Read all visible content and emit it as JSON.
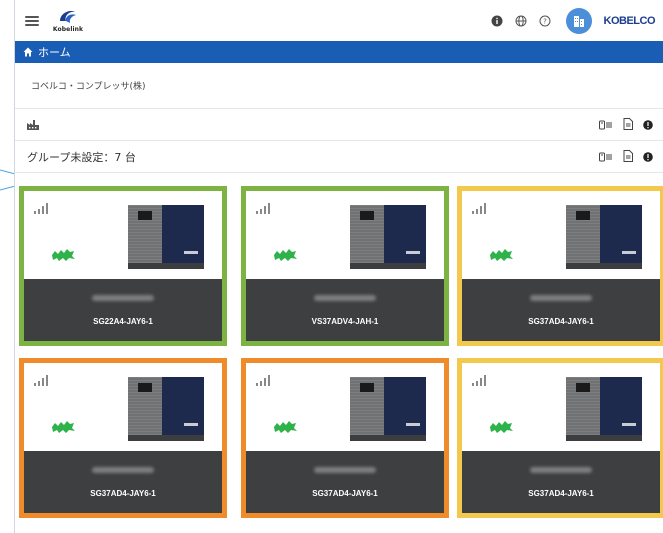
{
  "header": {
    "app_name": "Kobelink",
    "brand": "KOBELCO",
    "icons": [
      "info-icon",
      "globe-icon",
      "help-icon",
      "avatar"
    ]
  },
  "nav": {
    "home_label": "ホーム"
  },
  "company": {
    "name": "コベルコ・コンプレッサ(株)"
  },
  "group": {
    "label": "グループ未設定：7 台"
  },
  "cards": [
    {
      "model": "SG22A4-JAY6-1",
      "status_color": "#7cb342"
    },
    {
      "model": "VS37ADV4-JAH-1",
      "status_color": "#7cb342"
    },
    {
      "model": "SG37AD4-JAY6-1",
      "status_color": "#f2c94c"
    },
    {
      "model": "SG37AD4-JAY6-1",
      "status_color": "#f08b2c"
    },
    {
      "model": "SG37AD4-JAY6-1",
      "status_color": "#f08b2c"
    },
    {
      "model": "SG37AD4-JAY6-1",
      "status_color": "#f2c94c"
    }
  ],
  "colors": {
    "nav_bg": "#1a5db5",
    "card_bottom": "#3d3f40",
    "green": "#7cb342",
    "orange": "#f08b2c",
    "yellow": "#f2c94c"
  }
}
